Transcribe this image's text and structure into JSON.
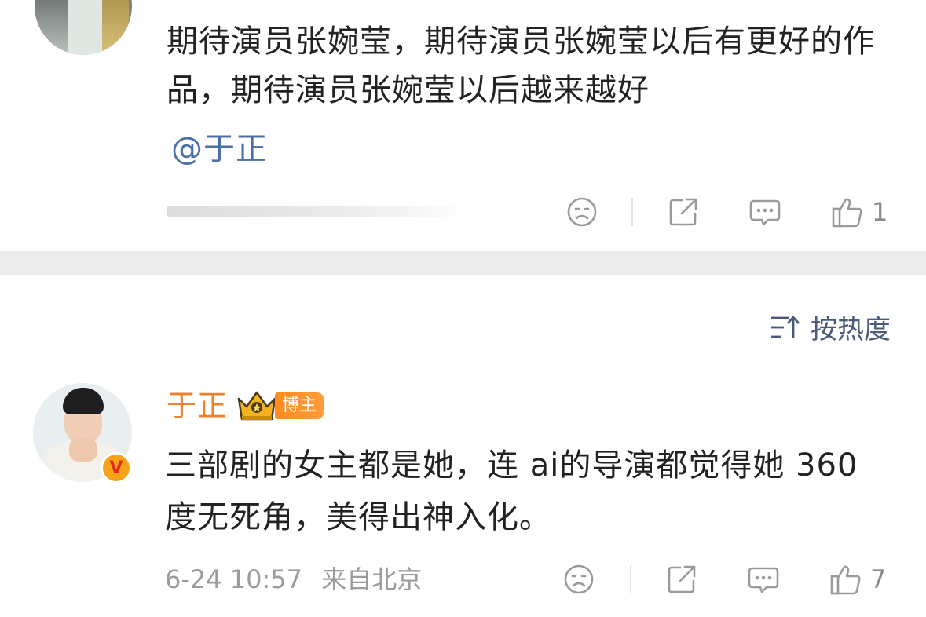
{
  "comment_top": {
    "text": "期待演员张婉莹，期待演员张婉莹以后有更好的作品，期待演员张婉莹以后越来越好",
    "mention": "@于正",
    "like_count": "1"
  },
  "sort": {
    "label": "按热度",
    "icon": "sort-icon"
  },
  "comment_main": {
    "username": "于正",
    "badge_label": "博主",
    "verified_mark": "V",
    "text": "三部剧的女主都是她，连 ai的导演都觉得她 360 度无死角，美得出神入化。",
    "date": "6-24 10:57",
    "location": "来自北京",
    "like_count": "7"
  },
  "icons": {
    "dislike": "sad-face-icon",
    "share": "share-icon",
    "reply": "comment-icon",
    "like": "thumbs-up-icon"
  },
  "colors": {
    "username": "#f07f2c",
    "mention": "#4a6fa5",
    "sort": "#4a5a78",
    "muted": "#9c9c9c",
    "badge": "#ff8a1f"
  }
}
